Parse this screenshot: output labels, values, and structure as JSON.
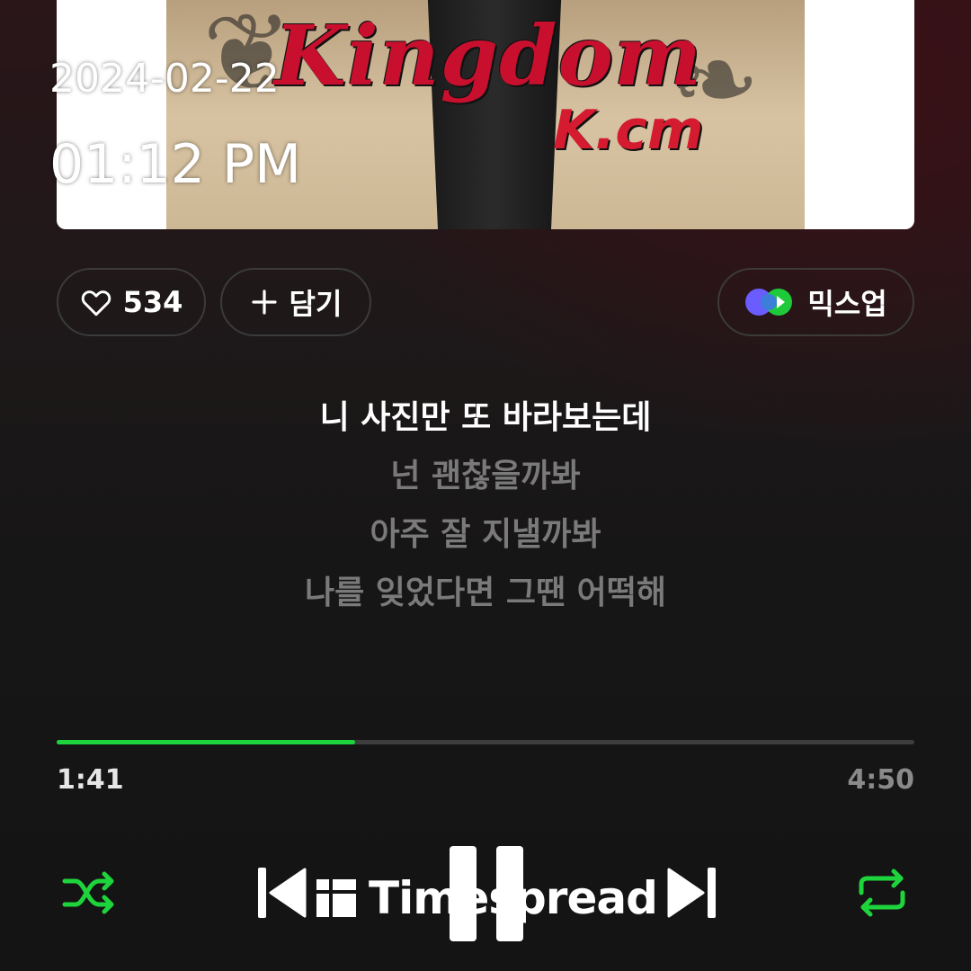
{
  "album": {
    "title_text": "Kingdom",
    "artist_text": "K.cm"
  },
  "overlay": {
    "date": "2024-02-22",
    "time": "01:12 PM"
  },
  "actions": {
    "like_count": "534",
    "add_label": "담기",
    "mixup_label": "믹스업"
  },
  "lyrics": [
    {
      "text": "니 사진만 또 바라보는데",
      "current": true
    },
    {
      "text": "넌 괜찮을까봐",
      "current": false
    },
    {
      "text": "아주 잘 지낼까봐",
      "current": false
    },
    {
      "text": "나를 잊었다면 그땐 어떡해",
      "current": false
    }
  ],
  "playback": {
    "current_time": "1:41",
    "total_time": "4:50",
    "progress_fraction": 0.348
  },
  "watermark": {
    "text": "Timespread"
  },
  "colors": {
    "accent_green": "#1ed43c",
    "background": "#161616"
  },
  "icons": {
    "like": "heart-icon",
    "add": "plus-icon",
    "mixup": "mixup-icon",
    "shuffle": "shuffle-icon",
    "prev": "skip-previous-icon",
    "pause": "pause-icon",
    "next": "skip-next-icon",
    "repeat": "repeat-icon"
  }
}
